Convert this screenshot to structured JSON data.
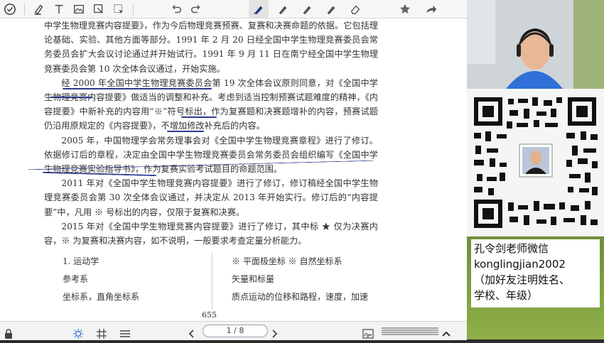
{
  "toolbar": {
    "icons": [
      "check-circle-icon",
      "highlighter-icon",
      "text-icon",
      "image-icon",
      "sticky-note-icon",
      "select-icon",
      "undo-icon",
      "redo-icon",
      "pen-icon",
      "pen-2-icon",
      "pen-3-icon",
      "pen-4-icon",
      "eraser-icon",
      "star-icon",
      "share-icon"
    ]
  },
  "document": {
    "paragraphs": [
      "中学生物理竞赛内容提要》，作为今后物理竞赛预赛、复赛和决赛命题的依据。它包括理论基础、实验、其他方面等部分。1991 年 2 月 20 日经全国中学生物理竞赛委员会常务委员会扩大会议讨论通过并开始试行。1991 年 9 月 11 日在南宁经全国中学生物理竞赛委员会第 10 次全体会议通过，开始实施。",
      "经 2000 年全国中学生物理竞赛委员会第 19 次全体会议原则同意，对《全国中学生物理竞赛内容提要》做适当的调整和补充。考虑到适当控制预赛试题难度的精神，《内容提要》中新补充的内容用“※”符号标出，作为复赛题和决赛题增补的内容，预赛试题仍沿用原规定的《内容提要》，不增加修改补充后的内容。",
      "2005 年，中国物理学会常务理事会对《全国中学生物理竞赛章程》进行了修订。依据修订后的章程，决定由全国中学生物理竞赛委员会常务委员会组织编写《全国中学生物理竞赛实验指导书》，作为复赛实验考试题目的命题范围。",
      "2011 年对《全国中学生物理竞赛内容提要》进行了修订，修订稿经全国中学生物理竞赛委员会第 30 次全体会议通过，并决定从 2013 年开始实行。修订后的“内容提要”中，凡用 ※ 号标出的内容，仅限于复赛和决赛。",
      "2015 年对《全国中学生物理竞赛内容提要》进行了修订，其中标 ★ 仅为决赛内容，※ 为复赛和决赛内容，如不说明，一般要求考查定量分析能力。"
    ],
    "toc_left": [
      "1. 运动学",
      "参考系",
      "坐标系，直角坐标系"
    ],
    "toc_right": [
      "※ 平面极坐标 ※ 自然坐标系",
      "矢量和标量",
      "质点运动的位移和路程，速度，加速"
    ],
    "page_number": "655"
  },
  "bottombar": {
    "page_indicator": "1 / 8",
    "icons": [
      "lock-icon",
      "brightness-icon",
      "grid-icon",
      "menu-icon",
      "prev-page-icon",
      "next-page-icon",
      "signature-icon",
      "lines-icon",
      "collapse-icon"
    ]
  },
  "contact": {
    "line1": "孔令剑老师微信",
    "line2": "konglingjian2002",
    "line3": "（加好友注明姓名、",
    "line4": "学校、年级）"
  },
  "colors": {
    "annotation": "#2b3a8f",
    "toolbar_bg": "#f6f6f6",
    "pen_blue": "#1e3a8a"
  }
}
